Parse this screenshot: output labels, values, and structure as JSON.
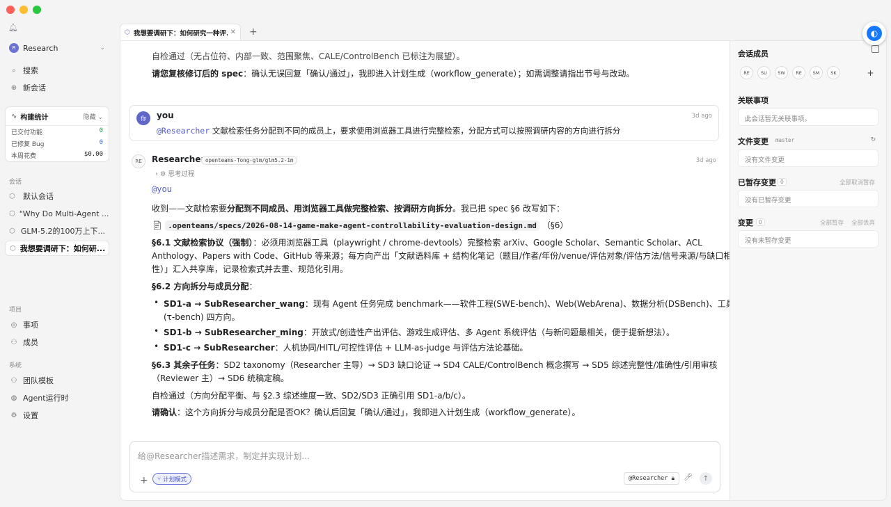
{
  "sidebar": {
    "workspace": {
      "avatar": "R",
      "name": "Research"
    },
    "nav": {
      "search": "搜索",
      "new_chat": "新会话"
    },
    "stats": {
      "title": "构建统计",
      "toggle": "隐藏",
      "rows": [
        {
          "label": "已交付功能",
          "value": "0",
          "color": "#1a9f4a"
        },
        {
          "label": "已修复 Bug",
          "value": "0",
          "color": "#3b6fd6"
        },
        {
          "label": "本周花费",
          "value": "$0.00",
          "color": "#222222"
        }
      ]
    },
    "conversations_label": "会话",
    "conversations": [
      {
        "label": "默认会话"
      },
      {
        "label": "\"Why Do Multi-Agent ..."
      },
      {
        "label": "GLM-5.2的100万上下..."
      },
      {
        "label": "我想要调研下：如何研..."
      }
    ],
    "project_label": "项目",
    "project_items": [
      {
        "label": "事项"
      },
      {
        "label": "成员"
      }
    ],
    "system_label": "系统",
    "system_items": [
      {
        "label": "团队模板"
      },
      {
        "label": "Agent运行时"
      },
      {
        "label": "设置"
      }
    ]
  },
  "tabs": [
    {
      "label": "我想要调研下：如何研究一种评..."
    }
  ],
  "chat": {
    "prev_line1": "自检通过（无占位符、内部一致、范围聚焦、CALE/ControlBench 已标注为展望）。",
    "prev_line2_bold": "请您复核修订后的 spec",
    "prev_line2_rest": "：确认无误回复「确认/通过」，我即进入计划生成（workflow_generate）；如需调整请指出节号与改动。",
    "user_msg": {
      "avatar": "你",
      "name": "you",
      "time": "3d ago",
      "mention": "@Researcher",
      "text": " 文献检索任务分配到不同的成员上，要求使用浏览器工具进行完整检索，分配方式可以按照调研内容的方向进行拆分"
    },
    "reply": {
      "avatar": "RE",
      "name": "Researcher",
      "model": "openteams-Tong-glm/glm5.2-1m",
      "time": "3d ago",
      "thinking": "思考过程",
      "mention": "@you",
      "intro_a": "收到——文献检索要",
      "intro_b": "分配到不同成员、用浏览器工具做完整检索、按调研方向拆分",
      "intro_c": "。我已把 spec §6 改写如下：",
      "file_path": ".openteams/specs/2026-08-14-game-make-agent-controllability-evaluation-design.md",
      "file_suffix": "（§6）",
      "s61_title": "§6.1 文献检索协议（强制）",
      "s61_line1": "：必须用浏览器工具（playwright / chrome-devtools）完整检索 arXiv、Google Scholar、Semantic Scholar、ACL",
      "s61_line2": "Anthology、Papers with Code、GitHub 等来源；每方向产出「文献语料库 + 结构化笔记（题目/作者/年份/venue/评估对象/评估方法/信号来源/与缺口相关",
      "s61_line3": "性）」汇入共享库，记录检索式并去重、规范化引用。",
      "s62_title": "§6.2 方向拆分与成员分配",
      "s62_colon": "：",
      "b1_title": "SD1-a → SubResearcher_wang",
      "b1_line1": "：现有 Agent 任务完成 benchmark——软件工程(SWE-bench)、Web(WebArena)、数据分析(DSBench)、工具调用",
      "b1_line2": "(τ-bench) 四方向。",
      "b2_title": "SD1-b → SubResearcher_ming",
      "b2_text": "：开放式/创造性产出评估、游戏生成评估、多 Agent 系统评估（与新问题最相关，便于提新想法）。",
      "b3_title": "SD1-c → SubResearcher",
      "b3_text": "：人机协同/HITL/可控性评估 + LLM-as-judge 与评估方法论基础。",
      "s63_title": "§6.3 其余子任务",
      "s63_line1": "：SD2 taxonomy（Researcher 主导）→ SD3 缺口论证 → SD4 CALE/ControlBench 概念撰写 → SD5 综述完整性/准确性/引用审核",
      "s63_line2": "（Reviewer 主）→ SD6 统稿定稿。",
      "check": "自检通过（方向分配平衡、与 §2.3 综述维度一致、SD2/SD3 正确引用 SD1-a/b/c）。",
      "confirm_bold": "请确认",
      "confirm_rest": "：这个方向拆分与成员分配是否OK？确认后回复「确认/通过」，我即进入计划生成（workflow_generate）。"
    }
  },
  "composer": {
    "placeholder": "给@Researcher描述需求，制定并实现计划...",
    "plan_mode": "计划模式",
    "agent": "@Researcher"
  },
  "right_panel": {
    "members_title": "会话成员",
    "members": [
      "RE",
      "SU",
      "SW",
      "RE",
      "SM",
      "SK"
    ],
    "related_title": "关联事项",
    "related_empty": "此会话暂无关联事项。",
    "files_title": "文件变更",
    "branch": "master",
    "files_empty": "没有文件变更",
    "staged_title": "已暂存变更",
    "staged_count": "0",
    "staged_action": "全部取消暂存",
    "staged_empty": "没有已暂存变更",
    "changes_title": "变更",
    "changes_count": "0",
    "changes_action1": "全部暂存",
    "changes_action2": "全部丢弃",
    "changes_empty": "没有未暂存变更"
  }
}
